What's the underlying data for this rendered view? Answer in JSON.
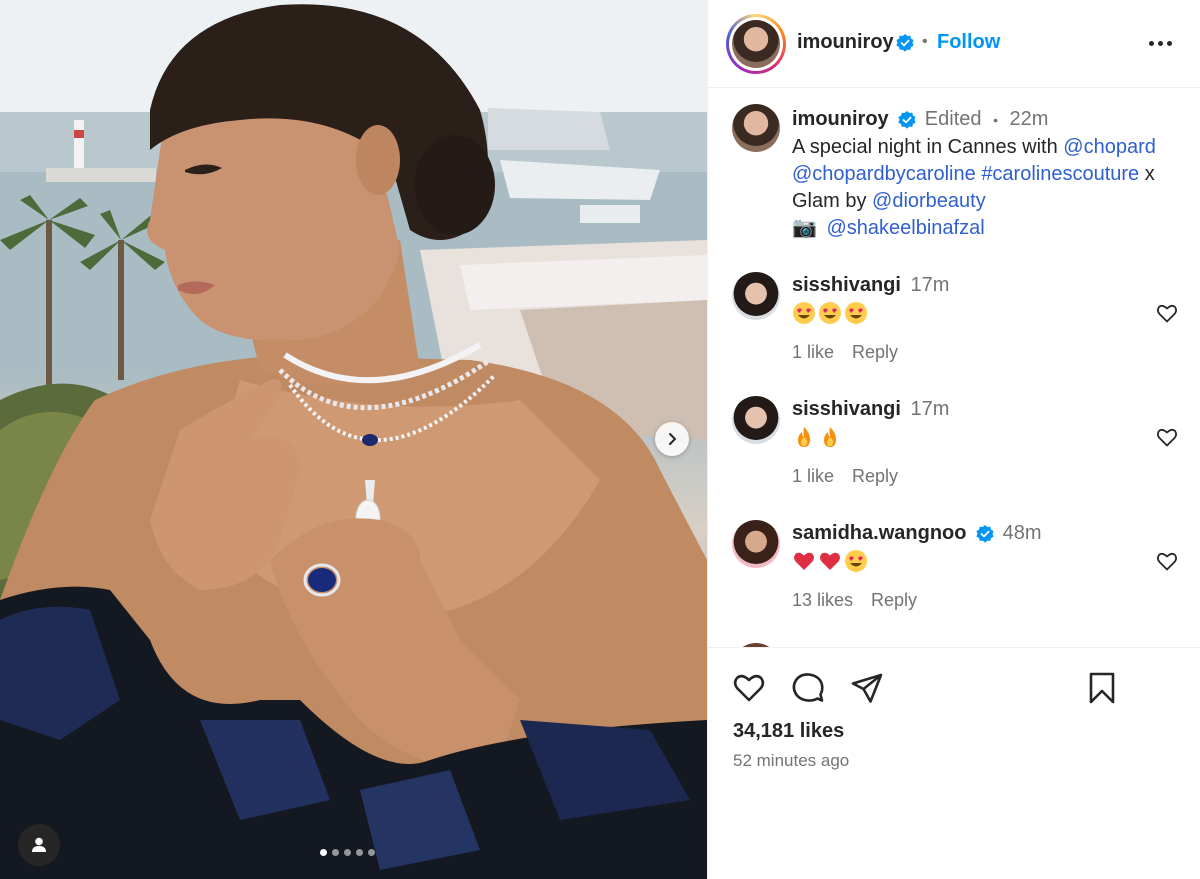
{
  "post": {
    "author": "imouniroy",
    "follow_label": "Follow",
    "separator": "•",
    "carousel_dots": 5,
    "active_dot": 0
  },
  "caption": {
    "username": "imouniroy",
    "edited": "Edited",
    "dot": "•",
    "time": "22m",
    "text_1": "A special night in Cannes with ",
    "mention_1": "@chopard",
    "mention_2": "@chopardbycaroline",
    "hashtag": "#carolinescouture",
    "text_2": " x",
    "text_3": "Glam by ",
    "mention_3": "@diorbeauty",
    "camera_emoji": "📷",
    "mention_4": "@shakeelbinafzal"
  },
  "comments": [
    {
      "username": "sisshivangi",
      "time": "17m",
      "emojis": [
        "heart-eyes",
        "heart-eyes",
        "heart-eyes"
      ],
      "likes": "1 like",
      "reply": "Reply"
    },
    {
      "username": "sisshivangi",
      "time": "17m",
      "emojis": [
        "fire",
        "fire"
      ],
      "likes": "1 like",
      "reply": "Reply"
    },
    {
      "username": "samidha.wangnoo",
      "time": "48m",
      "emojis": [
        "red-heart",
        "red-heart",
        "heart-eyes"
      ],
      "likes": "13 likes",
      "reply": "Reply"
    }
  ],
  "footer": {
    "likes": "34,181 likes",
    "posted": "52 minutes ago"
  },
  "colors": {
    "link": "#2f5fd0",
    "follow": "#0095f6",
    "verified": "#0095f6",
    "muted": "#737373"
  }
}
